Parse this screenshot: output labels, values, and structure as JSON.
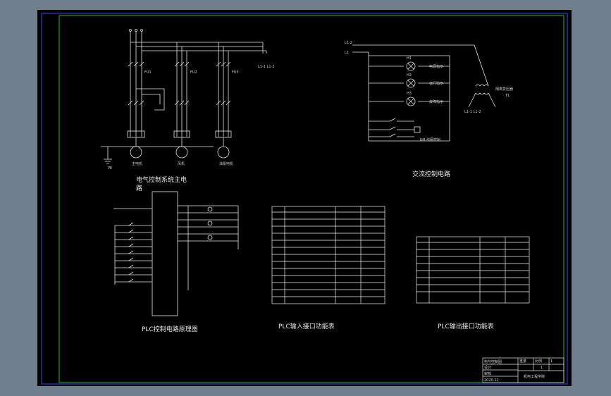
{
  "colors": {
    "viewport": "#6f7f8e",
    "paper": "#000000",
    "outer_frame": "#2e3bd8",
    "inner_frame": "#17c01e",
    "linework": "#e6e6e6",
    "table_lines": "#f0f0f0"
  },
  "captions": {
    "main_circuit_line1": "电气控制系统主电",
    "main_circuit_line2": "路",
    "ac_control_circuit": "交流控制电路",
    "plc_principle": "PLC控制电路原理图",
    "plc_input_table": "PLC输入接口功能表",
    "plc_output_table": "PLC输出接口功能表"
  },
  "ac_circuit": {
    "lamp_1": "H1",
    "lamp_2": "H2",
    "lamp_3": "H3",
    "lamp_1_text": "电源指示",
    "lamp_2_text": "运行指示",
    "lamp_3_text": "故障指示",
    "transformer": "隔离变压器",
    "transformer_tag": "T1",
    "rails": "L1-1  L1-2",
    "coil_text": "KM 线圈控制",
    "left_terminal": "L1",
    "top_terminal": "L1-2"
  },
  "main_circuit": {
    "breaker_1": "FU1",
    "breaker_2": "FU2",
    "breaker_3": "FU3",
    "motor_1": "主电机",
    "motor_2": "风机",
    "motor_3": "油泵电机",
    "ground": "PE"
  },
  "title_block": {
    "drawing_name": "电气控制图",
    "row_2": "设计",
    "row_3": "审核",
    "row_4": "2020.12",
    "weight_label": "重量",
    "ratio_label": "比例",
    "ratio_value": "1",
    "school": "机电工程学院",
    "extra": "1"
  }
}
